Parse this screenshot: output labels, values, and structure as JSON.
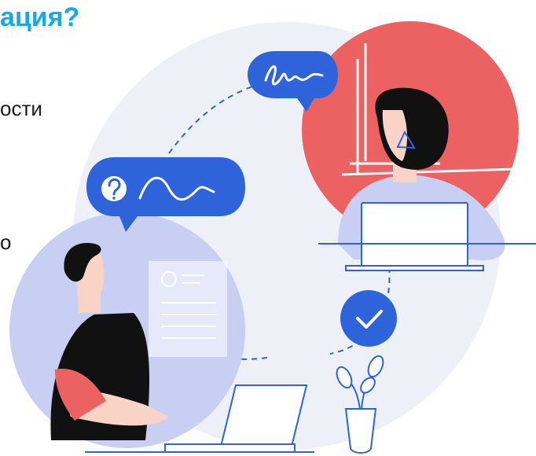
{
  "heading": "ация?",
  "lines": [
    "ости",
    "о"
  ],
  "colors": {
    "accent_text": "#1aa7e6",
    "bubble_blue": "#2f63d9",
    "circle_lavender": "#c9cff3",
    "circle_red": "#ec6262",
    "background_circle": "#eef0f8",
    "outline": "#2f63d9"
  },
  "icons": [
    "signature-icon",
    "question-icon",
    "wave-icon",
    "check-icon",
    "document-icon"
  ]
}
